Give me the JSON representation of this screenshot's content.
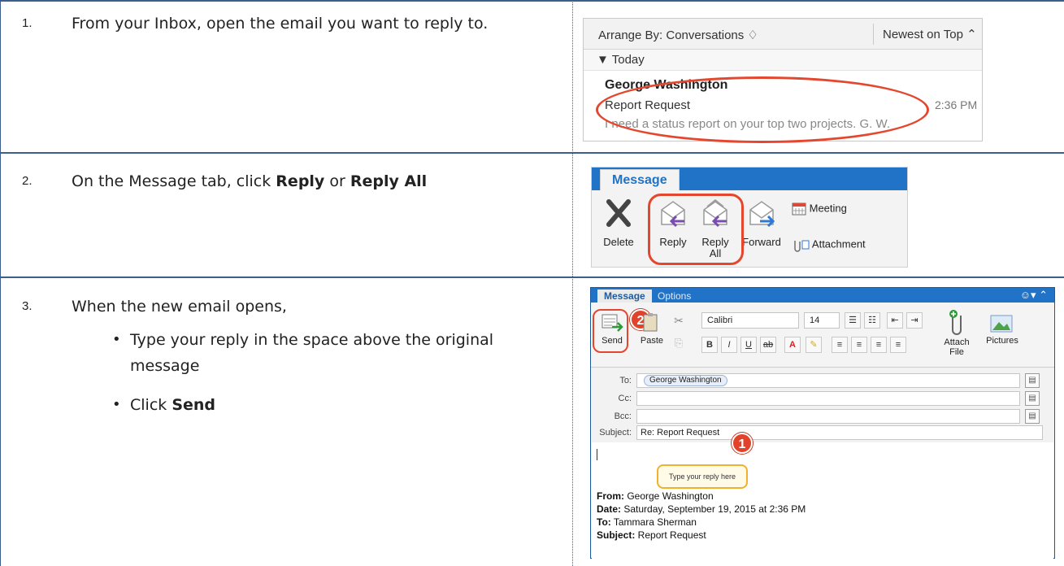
{
  "steps": [
    {
      "num": "1.",
      "text": "From your Inbox, open the email you want to reply to."
    },
    {
      "num": "2.",
      "text_pre": "On the Message tab, click ",
      "bold1": "Reply",
      "text_mid": " or ",
      "bold2": "Reply All"
    },
    {
      "num": "3.",
      "text": "When the new email opens,",
      "bullet1": "Type your reply in the space above the original message",
      "bullet2_pre": "Click ",
      "bullet2_bold": "Send"
    }
  ],
  "inbox": {
    "arrange_by": "Arrange By: Conversations ♢",
    "newest": "Newest on Top ⌃",
    "today": "▼ Today",
    "sender": "George Washington",
    "subject": "Report Request",
    "preview": "I need a status report on your top two projects. G. W.",
    "time": "2:36 PM"
  },
  "ribbon": {
    "tab": "Message",
    "delete": "Delete",
    "reply": "Reply",
    "reply_all": "Reply All",
    "forward": "Forward",
    "meeting": "Meeting",
    "attachment": "Attachment"
  },
  "compose": {
    "tab_message": "Message",
    "tab_options": "Options",
    "smile": "☺▾ ⌃",
    "send": "Send",
    "paste": "Paste",
    "font": "Calibri",
    "size": "14",
    "attach_file": "Attach File",
    "pictures": "Pictures",
    "badge2": "2",
    "badge1": "1",
    "to_label": "To:",
    "cc_label": "Cc:",
    "bcc_label": "Bcc:",
    "subject_label": "Subject:",
    "to_value": "George Washington",
    "subject_value": "Re: Report Request",
    "callout": "Type your reply here",
    "from_label": "From:",
    "from_value": " George Washington",
    "date_label": "Date:",
    "date_value": " Saturday, September 19, 2015 at 2:36 PM",
    "to2_label": "To:",
    "to2_value": " Tammara Sherman",
    "subj2_label": "Subject:",
    "subj2_value": " Report Request"
  },
  "colors": {
    "accent": "#2073c7",
    "highlight": "#e4472e",
    "rule": "#3b5f8a"
  }
}
